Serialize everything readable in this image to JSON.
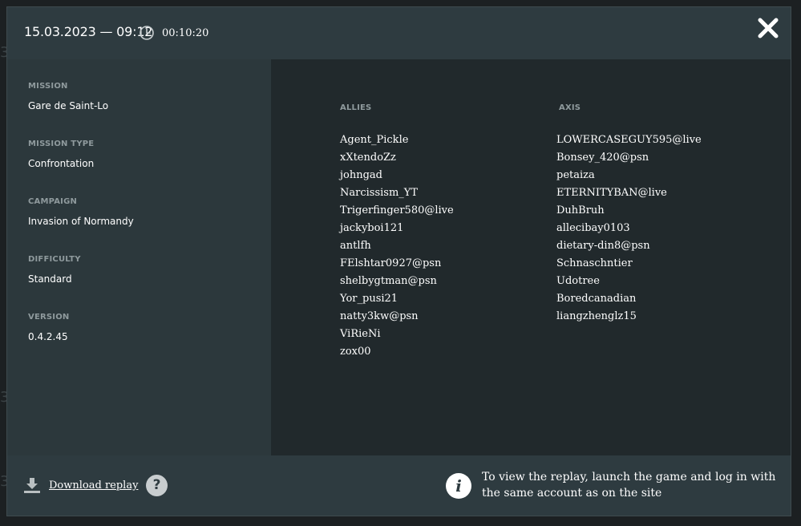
{
  "header": {
    "datetime": "15.03.2023 — 09:12",
    "duration": "00:10:20",
    "clock_icon": "clock-icon",
    "close_icon": "close-icon"
  },
  "info": {
    "mission": {
      "label": "MISSION",
      "value": "Gare de Saint-Lo"
    },
    "mission_type": {
      "label": "MISSION TYPE",
      "value": "Confrontation"
    },
    "campaign": {
      "label": "CAMPAIGN",
      "value": "Invasion of Normandy"
    },
    "difficulty": {
      "label": "DIFFICULTY",
      "value": "Standard"
    },
    "version": {
      "label": "VERSION",
      "value": "0.4.2.45"
    }
  },
  "teams": {
    "allies": {
      "title": "ALLIES",
      "players": [
        "Agent_Pickle",
        "xXtendoZz",
        "johngad",
        "Narcissism_YT",
        "Trigerfinger580@live",
        "jackyboi121",
        "antlfh",
        "FElshtar0927@psn",
        "shelbygtman@psn",
        "Yor_pusi21",
        "natty3kw@psn",
        "ViRieNi",
        "zox00"
      ]
    },
    "axis": {
      "title": "AXIS",
      "players": [
        "LOWERCASEGUY595@live",
        "Bonsey_420@psn",
        "petaiza",
        "ETERNITYBAN@live",
        "DuhBruh",
        "allecibay0103",
        "dietary-din8@psn",
        "Schnaschntier",
        "Udotree",
        "Boredcanadian",
        "liangzhenglz15"
      ]
    }
  },
  "footer": {
    "download_label": "Download replay",
    "help_symbol": "?",
    "info_symbol": "i",
    "note": "To view the replay, launch the game and log in with the same account as on the site"
  },
  "colors": {
    "header_bg": "#2e3b40",
    "info_panel_bg": "#2c383c",
    "players_panel_bg": "#21292c",
    "label": "#8f9a9d",
    "text": "#ffffff"
  }
}
